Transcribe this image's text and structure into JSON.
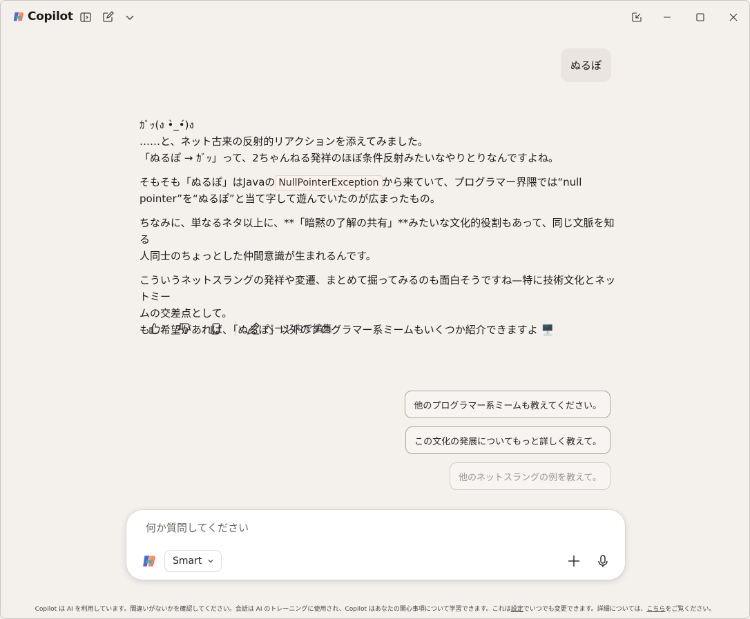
{
  "app": {
    "title": "Copilot"
  },
  "conversation": {
    "user_message": "ぬるぽ",
    "assistant": {
      "line1": "ｶﾞｯ(ง •̀_•́)ง",
      "line2": "……と、ネット古来の反射的リアクションを添えてみました。",
      "line3": "「ぬるぽ → ｶﾞｯ」って、2ちゃんねる発祥のほぼ条件反射みたいなやりとりなんですよね。",
      "p2_before": "そもそも「ぬるぽ」はJavaの",
      "p2_code": "NullPointerException",
      "p2_after": "から来ていて、プログラマー界隈では“null",
      "p2_line2": "pointer”を“ぬるぽ”と当て字して遊んでいたのが広まったもの。",
      "p3_line1": "ちなみに、単なるネタ以上に、**「暗黙の了解の共有」**みたいな文化的役割もあって、同じ文脈を知る",
      "p3_line2": "人同士のちょっとした仲間意識が生まれるんです。",
      "p4_line1": "こういうネットスラングの発祥や変遷、まとめて掘ってみるのも面白そうですね—特に技術文化とネットミー",
      "p4_line2": "ムの交差点として。",
      "p4_line3": "もし希望があれば、「ぬるぽ」以外のプログラマー系ミームもいくつか紹介できますよ 🖥️"
    },
    "actions": {
      "edit_label": "ページ内で編集"
    }
  },
  "suggestions": [
    "他のプログラマー系ミームも教えてください。",
    "この文化の発展についてもっと詳しく教えて。",
    "他のネットスラングの例を教えて。"
  ],
  "composer": {
    "placeholder": "何か質問してください",
    "mode": "Smart"
  },
  "footer": {
    "text_before": "Copilot は AI を利用しています。間違いがないかを確認してください。会話は AI のトレーニングに使用され、Copilot はあなたの関心事項について学習できます。これは",
    "settings_link": "設定",
    "text_middle": "でいつでも変更できます。詳細については、",
    "here_link": "こちら",
    "text_after": "をご覧ください。"
  }
}
